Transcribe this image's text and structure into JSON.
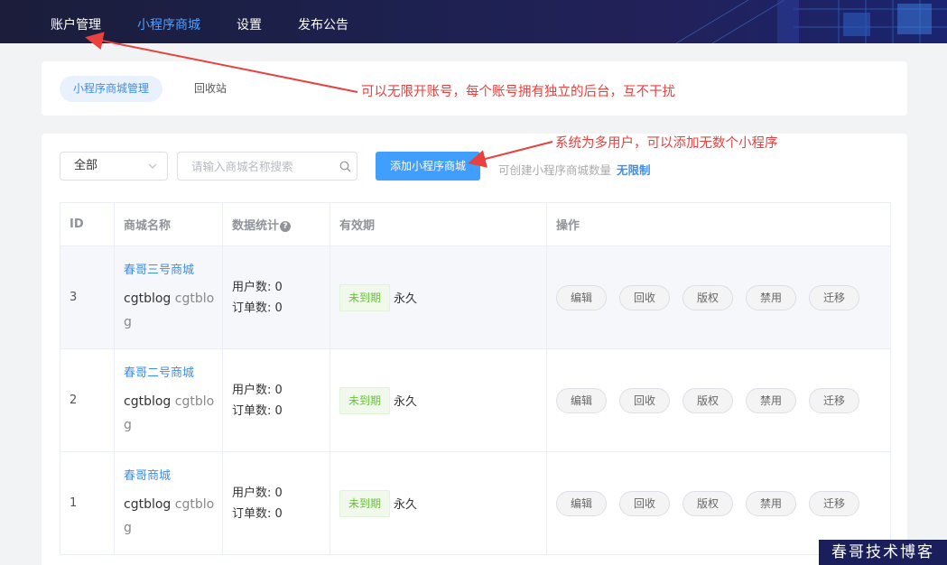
{
  "topnav": {
    "items": [
      {
        "label": "账户管理",
        "active": false
      },
      {
        "label": "小程序商城",
        "active": true
      },
      {
        "label": "设置",
        "active": false
      },
      {
        "label": "发布公告",
        "active": false
      }
    ]
  },
  "subtabs": {
    "items": [
      {
        "label": "小程序商城管理",
        "active": true
      },
      {
        "label": "回收站",
        "active": false
      }
    ]
  },
  "toolbar": {
    "filter_value": "全部",
    "search_placeholder": "请输入商城名称搜索",
    "add_label": "添加小程序商城",
    "quota_label": "可创建小程序商城数量",
    "quota_value": "无限制"
  },
  "table": {
    "headers": [
      "ID",
      "商城名称",
      "数据统计",
      "有效期",
      "操作"
    ],
    "rows": [
      {
        "id": "3",
        "name": "春哥三号商城",
        "owner_a": "cgtblog",
        "owner_b": "cgtblog",
        "users": "用户数: 0",
        "orders": "订单数: 0",
        "status": "未到期",
        "validity": "永久"
      },
      {
        "id": "2",
        "name": "春哥二号商城",
        "owner_a": "cgtblog",
        "owner_b": "cgtblog",
        "users": "用户数: 0",
        "orders": "订单数: 0",
        "status": "未到期",
        "validity": "永久"
      },
      {
        "id": "1",
        "name": "春哥商城",
        "owner_a": "cgtblog",
        "owner_b": "cgtblog",
        "users": "用户数: 0",
        "orders": "订单数: 0",
        "status": "未到期",
        "validity": "永久"
      }
    ],
    "actions": [
      "编辑",
      "回收",
      "版权",
      "禁用",
      "迁移"
    ]
  },
  "annotations": {
    "note1": "可以无限开账号，每个账号拥有独立的后台，互不干扰",
    "note2": "系统为多用户，可以添加无数个小程序"
  },
  "watermark": "春哥技术博客",
  "colors": {
    "accent": "#409eff",
    "nav_bg": "#1d2150",
    "annotation": "#e8413e",
    "status_green": "#67c23a"
  }
}
